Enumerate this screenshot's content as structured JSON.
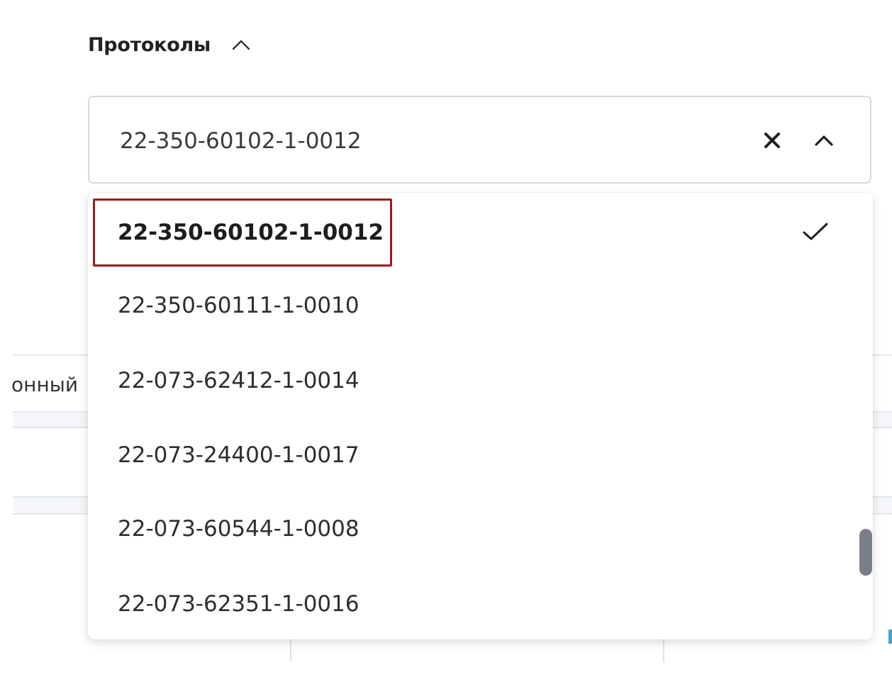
{
  "section": {
    "title": "Протоколы",
    "toggle_icon": "chevron-up-icon"
  },
  "background_table": {
    "header_partial": "онный"
  },
  "select": {
    "value": "22-350-60102-1-0012",
    "clear_icon": "close-icon",
    "toggle_icon": "chevron-up-icon"
  },
  "dropdown": {
    "options": [
      {
        "label": "22-350-60102-1-0012",
        "selected": true
      },
      {
        "label": "22-350-60111-1-0010",
        "selected": false
      },
      {
        "label": "22-073-62412-1-0014",
        "selected": false
      },
      {
        "label": "22-073-24400-1-0017",
        "selected": false
      },
      {
        "label": "22-073-60544-1-0008",
        "selected": false
      },
      {
        "label": "22-073-62351-1-0016",
        "selected": false
      }
    ],
    "selected_icon": "check-icon"
  },
  "colors": {
    "highlight_border": "#9b1c1c",
    "field_border": "#d5d9de",
    "scrollbar": "#7a7f87",
    "text": "#2e2e2e"
  }
}
